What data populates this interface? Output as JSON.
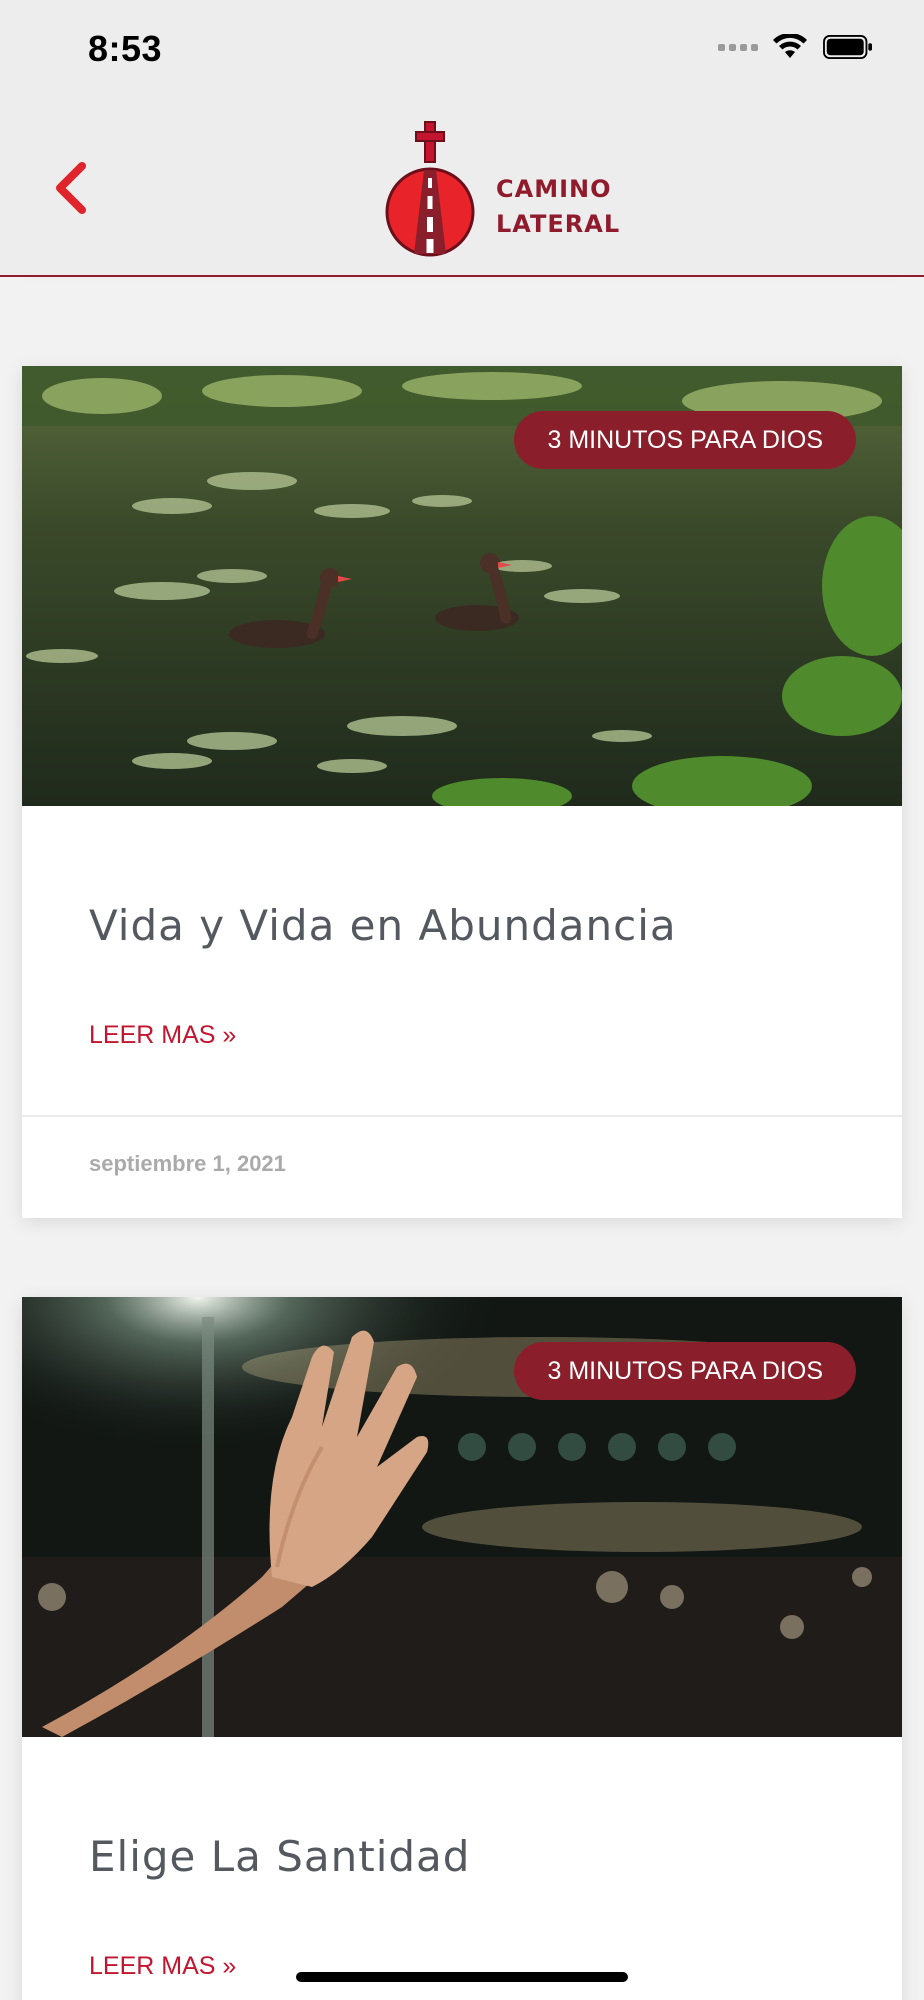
{
  "status_bar": {
    "time": "8:53",
    "icons": [
      "cellular-signal-icon",
      "wifi-icon",
      "battery-icon"
    ]
  },
  "header": {
    "back_icon": "chevron-left-icon",
    "logo": {
      "line1": "CAMINO",
      "line2": "LATERAL"
    },
    "colors": {
      "brand": "#8f1b2c",
      "accent": "#e8232a"
    }
  },
  "posts": [
    {
      "category": "3 MINUTOS PARA DIOS",
      "title": "Vida y Vida en Abundancia",
      "read_more": "LEER MAS »",
      "date": "septiembre 1, 2021",
      "image": "ducks-on-pond"
    },
    {
      "category": "3 MINUTOS PARA DIOS",
      "title": "Elige La Santidad",
      "read_more": "LEER MAS »",
      "image": "raised-hand-night-crowd"
    }
  ]
}
